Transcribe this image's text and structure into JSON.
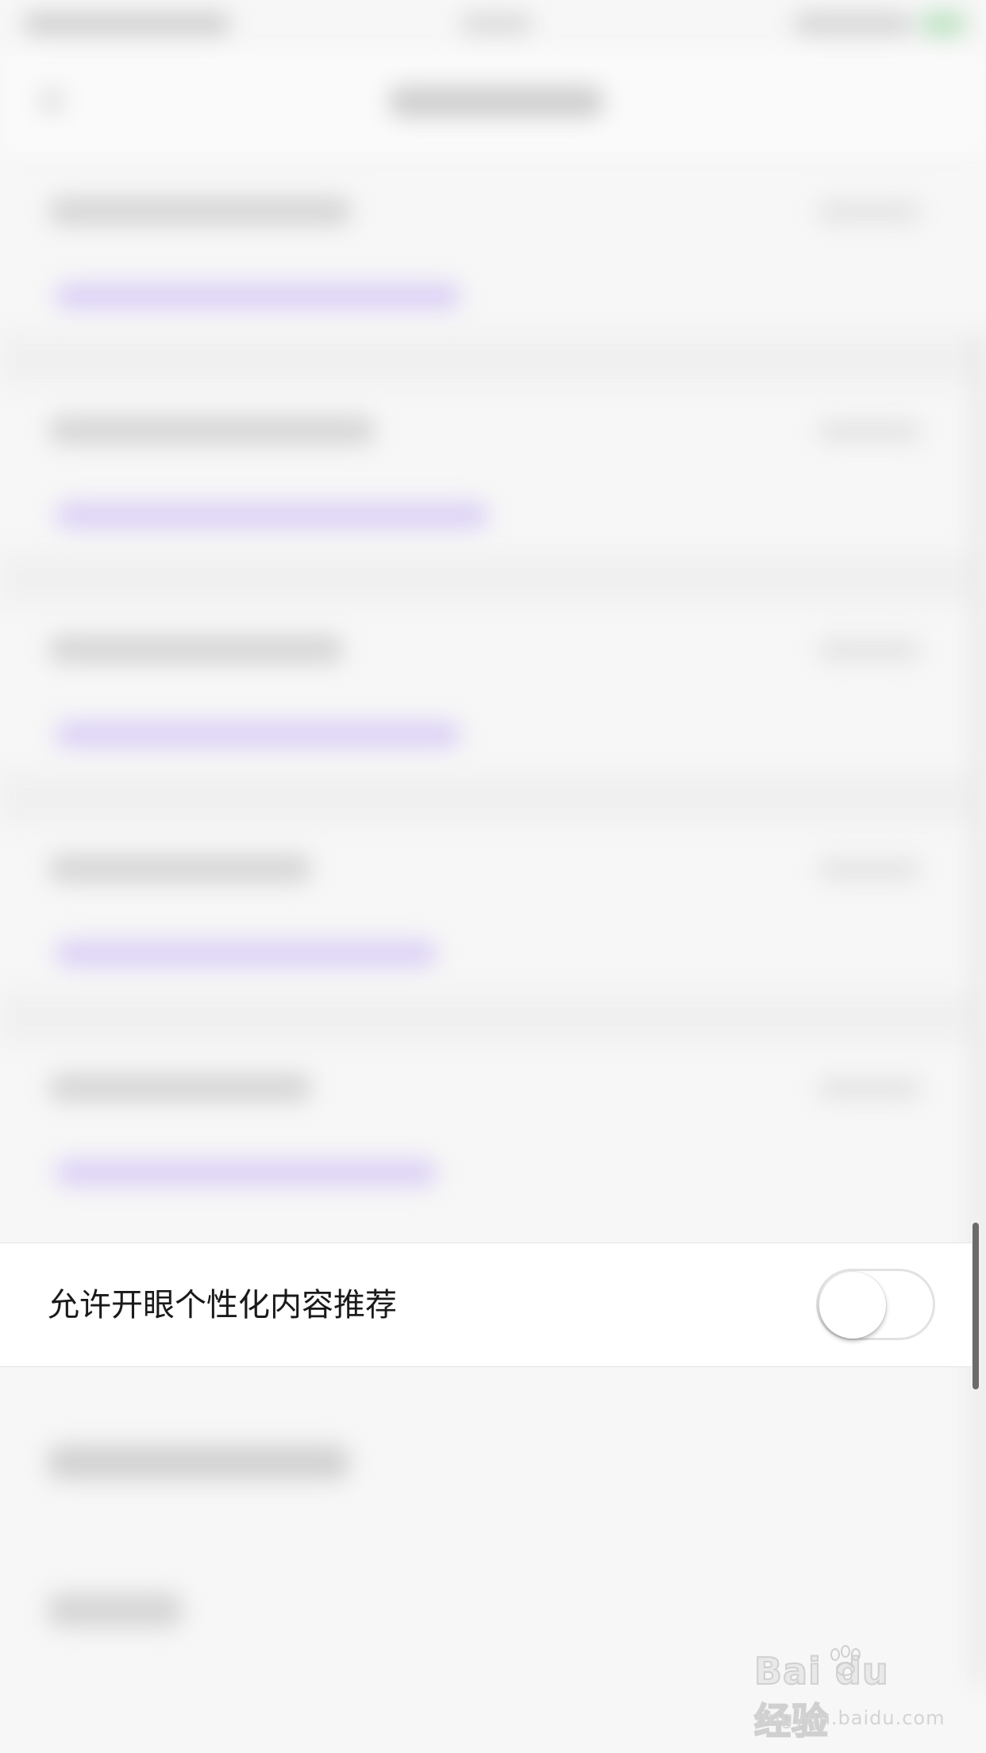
{
  "settings_row": {
    "label": "允许开眼个性化内容推荐",
    "toggle_state": "off"
  },
  "watermark": {
    "logo": "Bai du 经验",
    "url": "jingyan.baidu.com"
  },
  "colors": {
    "row_background": "#ffffff",
    "page_background": "#f7f7f7",
    "toggle_border": "#e2e2e2",
    "link_placeholder": "#dcd1f6"
  }
}
